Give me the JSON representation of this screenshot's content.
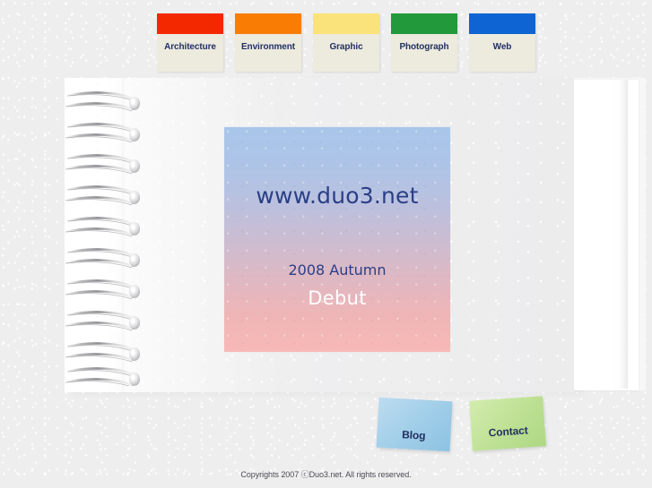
{
  "site": {
    "brand_url": "www.duo3.net",
    "season": "2008 Autumn",
    "debut": "Debut",
    "footer": "Copyrights 2007 ⓒDuo3.net. All rights reserved."
  },
  "nav": {
    "tabs": [
      {
        "label": "Architecture",
        "color": "#f42800"
      },
      {
        "label": "Environment",
        "color": "#f97d05"
      },
      {
        "label": "Graphic",
        "color": "#fae37a"
      },
      {
        "label": "Photograph",
        "color": "#22993a"
      },
      {
        "label": "Web",
        "color": "#0e64d2"
      }
    ]
  },
  "sticky_tabs": [
    {
      "label": "Blog",
      "color": "#9fcde8"
    },
    {
      "label": "Contact",
      "color": "#bde093"
    }
  ],
  "notebook": {
    "ring_count": 10,
    "page_color": "#efeff0"
  },
  "colors": {
    "background": "#eeeeee",
    "tab_paper": "#edeade",
    "heading_text": "#2a3f86",
    "hero_top": "#a8c6ea",
    "hero_bottom": "#f7b9b7"
  }
}
